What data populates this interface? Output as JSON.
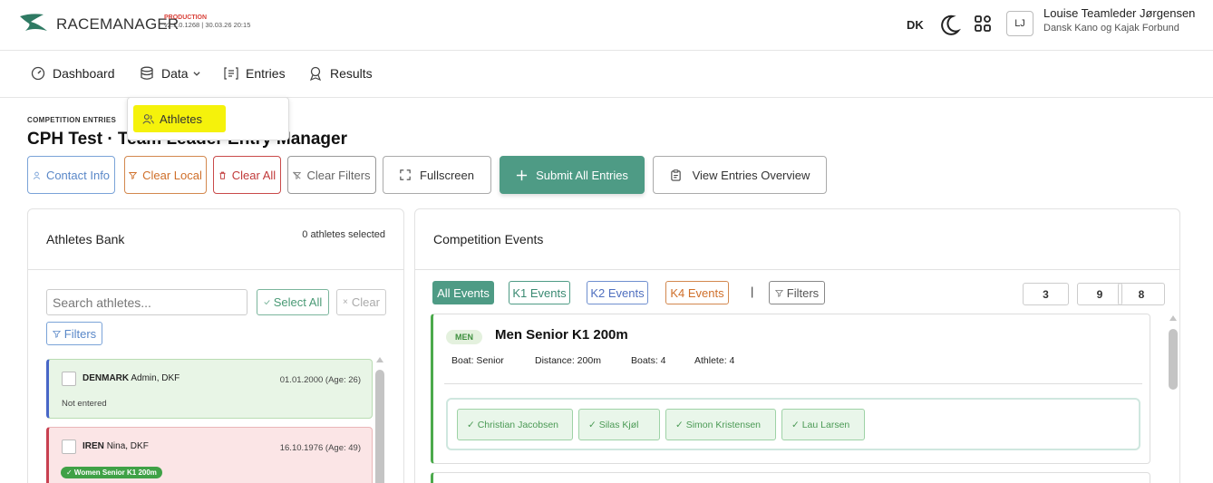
{
  "brand": {
    "name": "RACEMANAGER",
    "env": "PRODUCTION",
    "version": "v2.1.0.1268 | 30.03.26 20:15"
  },
  "header": {
    "lang": "DK",
    "avatar_initials": "LJ",
    "user_name": "Louise Teamleder Jørgensen",
    "user_org": "Dansk Kano og Kajak Forbund"
  },
  "nav": {
    "dashboard": "Dashboard",
    "data": "Data",
    "entries": "Entries",
    "results": "Results"
  },
  "dropdown": {
    "athletes": "Athletes"
  },
  "page": {
    "kicker": "COMPETITION ENTRIES",
    "title": "CPH Test  · Team Leader Entry Manager"
  },
  "toolbar": {
    "contact_info": "Contact Info",
    "clear_local": "Clear Local",
    "clear_all": "Clear All",
    "clear_filters": "Clear Filters",
    "fullscreen": "Fullscreen",
    "submit_all": "Submit All Entries",
    "view_overview": "View Entries Overview"
  },
  "athletes_bank": {
    "title": "Athletes Bank",
    "selected": "0 athletes selected",
    "search_placeholder": "Search athletes...",
    "select_all": "Select All",
    "clear": "Clear",
    "filters": "Filters",
    "athletes": [
      {
        "country": "DENMARK",
        "name": "Admin, DKF",
        "dob": "01.01.2000 (Age: 26)",
        "status": "Not entered"
      },
      {
        "country": "IREN",
        "name": "Nina, DKF",
        "dob": "16.10.1976 (Age: 49)",
        "badge": "✓ Women Senior K1 200m"
      }
    ]
  },
  "events": {
    "title": "Competition Events",
    "tabs": {
      "all": "All Events",
      "k1": "K1 Events",
      "k2": "K2 Events",
      "k4": "K4 Events",
      "sep": "|",
      "filters": "Filters"
    },
    "counts": [
      "3",
      "9",
      "8"
    ],
    "event": {
      "pill": "MEN",
      "title": "Men Senior K1 200m",
      "boat": "Boat: Senior",
      "distance": "Distance: 200m",
      "boats": "Boats: 4",
      "athlete": "Athlete: 4",
      "entries": [
        "✓ Christian Jacobsen",
        "✓ Silas Kjøl",
        "✓ Simon Kristensen",
        "✓ Lau Larsen"
      ]
    }
  },
  "colors": {
    "accent": "#4e9b85",
    "highlight": "#f5f20b",
    "danger": "#c13a3a",
    "warning": "#cf6f2a",
    "info": "#5a88c8"
  }
}
